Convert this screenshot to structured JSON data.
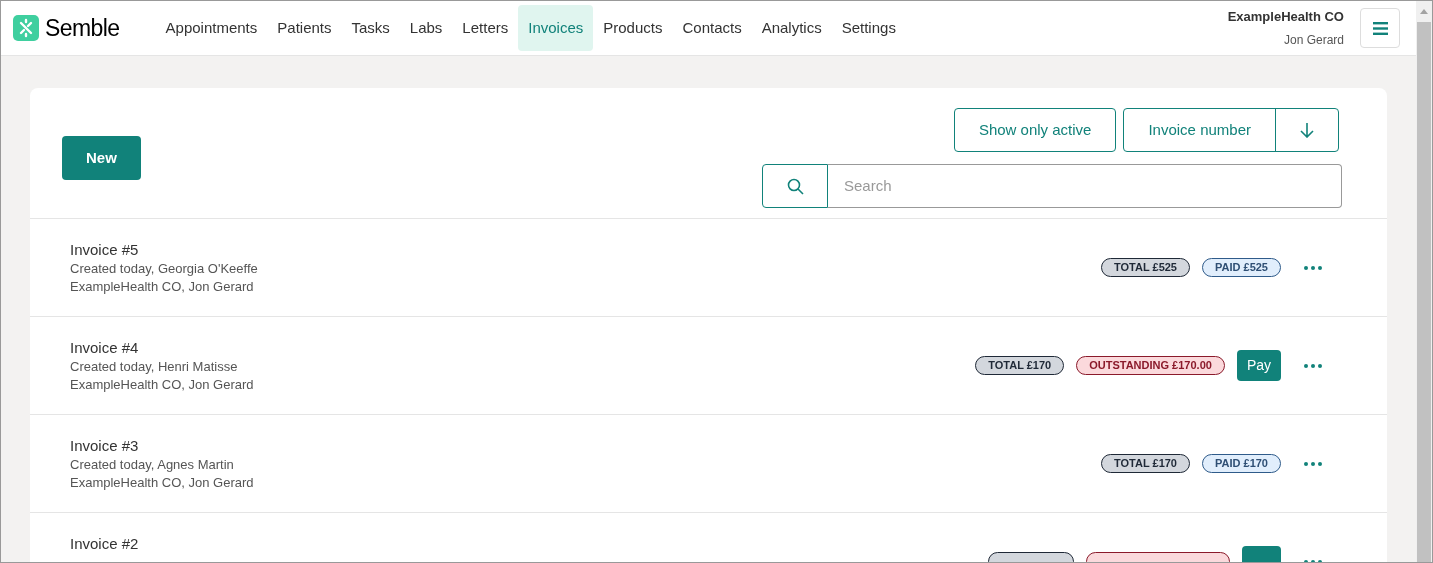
{
  "brand": "Semble",
  "nav": [
    {
      "label": "Appointments",
      "selected": false
    },
    {
      "label": "Patients",
      "selected": false
    },
    {
      "label": "Tasks",
      "selected": false
    },
    {
      "label": "Labs",
      "selected": false
    },
    {
      "label": "Letters",
      "selected": false
    },
    {
      "label": "Invoices",
      "selected": true
    },
    {
      "label": "Products",
      "selected": false
    },
    {
      "label": "Contacts",
      "selected": false
    },
    {
      "label": "Analytics",
      "selected": false
    },
    {
      "label": "Settings",
      "selected": false
    }
  ],
  "account": {
    "organisation": "ExampleHealth CO",
    "user": "Jon Gerard"
  },
  "toolbar": {
    "new_button": "New",
    "filter_button": "Show only active",
    "sort_field": "Invoice number",
    "search": {
      "placeholder": "Search"
    }
  },
  "invoices": [
    {
      "title": "Invoice #5",
      "created": "Created today, Georgia O'Keeffe",
      "account": "ExampleHealth CO, Jon Gerard",
      "badges": [
        {
          "kind": "total",
          "label": "TOTAL £525"
        },
        {
          "kind": "paid",
          "label": "PAID £525"
        }
      ],
      "payable": false
    },
    {
      "title": "Invoice #4",
      "created": "Created today, Henri Matisse",
      "account": "ExampleHealth CO, Jon Gerard",
      "badges": [
        {
          "kind": "total",
          "label": "TOTAL £170"
        },
        {
          "kind": "outstanding",
          "label": "OUTSTANDING £170.00"
        }
      ],
      "payable": true,
      "pay_label": "Pay"
    },
    {
      "title": "Invoice #3",
      "created": "Created today, Agnes Martin",
      "account": "ExampleHealth CO, Jon Gerard",
      "badges": [
        {
          "kind": "total",
          "label": "TOTAL £170"
        },
        {
          "kind": "paid",
          "label": "PAID £170"
        }
      ],
      "payable": false
    },
    {
      "title": "Invoice #2",
      "badges": [
        {
          "kind": "total"
        },
        {
          "kind": "outstanding"
        }
      ],
      "payable": true
    }
  ]
}
